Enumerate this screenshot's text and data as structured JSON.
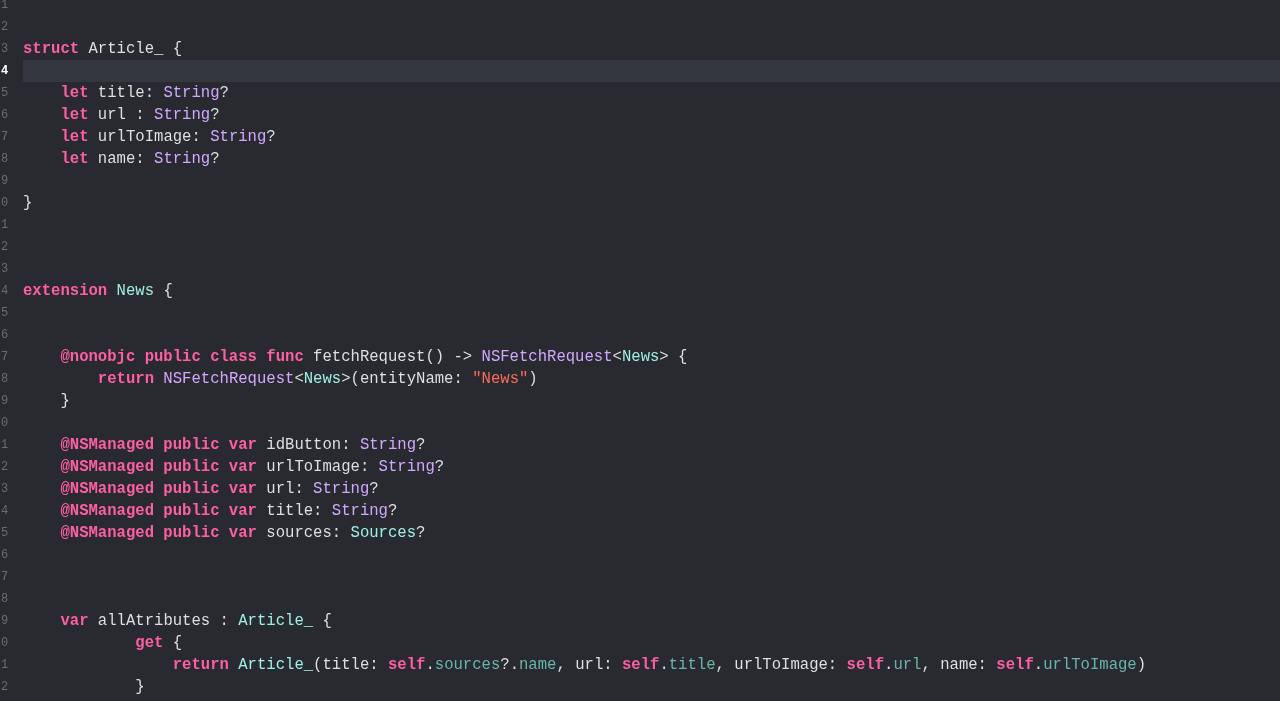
{
  "editor": {
    "lines": [
      {
        "number": "1",
        "current": false
      },
      {
        "number": "2",
        "current": false
      },
      {
        "number": "3",
        "current": false,
        "tokens": [
          {
            "kind": "keyword",
            "text": "struct"
          },
          {
            "kind": "plain",
            "text": " Article_ {"
          }
        ]
      },
      {
        "number": "4",
        "current": true
      },
      {
        "number": "5",
        "current": false,
        "tokens": [
          {
            "kind": "keyword",
            "text": "    let"
          },
          {
            "kind": "plain",
            "text": " title: "
          },
          {
            "kind": "type",
            "text": "String"
          },
          {
            "kind": "plain",
            "text": "?"
          }
        ]
      },
      {
        "number": "6",
        "current": false,
        "tokens": [
          {
            "kind": "keyword",
            "text": "    let"
          },
          {
            "kind": "plain",
            "text": " url : "
          },
          {
            "kind": "type",
            "text": "String"
          },
          {
            "kind": "plain",
            "text": "?"
          }
        ]
      },
      {
        "number": "7",
        "current": false,
        "tokens": [
          {
            "kind": "keyword",
            "text": "    let"
          },
          {
            "kind": "plain",
            "text": " urlToImage: "
          },
          {
            "kind": "type",
            "text": "String"
          },
          {
            "kind": "plain",
            "text": "?"
          }
        ]
      },
      {
        "number": "8",
        "current": false,
        "tokens": [
          {
            "kind": "keyword",
            "text": "    let"
          },
          {
            "kind": "plain",
            "text": " name: "
          },
          {
            "kind": "type",
            "text": "String"
          },
          {
            "kind": "plain",
            "text": "?"
          }
        ]
      },
      {
        "number": "9",
        "current": false
      },
      {
        "number": "0",
        "current": false,
        "tokens": [
          {
            "kind": "plain",
            "text": "}"
          }
        ]
      },
      {
        "number": "1",
        "current": false
      },
      {
        "number": "2",
        "current": false
      },
      {
        "number": "3",
        "current": false
      },
      {
        "number": "4",
        "current": false,
        "tokens": [
          {
            "kind": "keyword",
            "text": "extension"
          },
          {
            "kind": "project-type",
            "text": " News"
          },
          {
            "kind": "plain",
            "text": " {"
          }
        ]
      },
      {
        "number": "5",
        "current": false
      },
      {
        "number": "6",
        "current": false
      },
      {
        "number": "7",
        "current": false,
        "tokens": [
          {
            "kind": "keyword",
            "text": "    @nonobjc public class func"
          },
          {
            "kind": "plain",
            "text": " fetchRequest() -> "
          },
          {
            "kind": "type",
            "text": "NSFetchRequest"
          },
          {
            "kind": "plain",
            "text": "<"
          },
          {
            "kind": "project-type",
            "text": "News"
          },
          {
            "kind": "plain",
            "text": "> {"
          }
        ]
      },
      {
        "number": "8",
        "current": false,
        "tokens": [
          {
            "kind": "keyword",
            "text": "        return"
          },
          {
            "kind": "type",
            "text": " NSFetchRequest"
          },
          {
            "kind": "plain",
            "text": "<"
          },
          {
            "kind": "project-type",
            "text": "News"
          },
          {
            "kind": "plain",
            "text": ">(entityName: "
          },
          {
            "kind": "string",
            "text": "\"News\""
          },
          {
            "kind": "plain",
            "text": ")"
          }
        ]
      },
      {
        "number": "9",
        "current": false,
        "tokens": [
          {
            "kind": "plain",
            "text": "    }"
          }
        ]
      },
      {
        "number": "0",
        "current": false
      },
      {
        "number": "1",
        "current": false,
        "tokens": [
          {
            "kind": "keyword",
            "text": "    @NSManaged public var"
          },
          {
            "kind": "plain",
            "text": " idButton: "
          },
          {
            "kind": "type",
            "text": "String"
          },
          {
            "kind": "plain",
            "text": "?"
          }
        ]
      },
      {
        "number": "2",
        "current": false,
        "tokens": [
          {
            "kind": "keyword",
            "text": "    @NSManaged public var"
          },
          {
            "kind": "plain",
            "text": " urlToImage: "
          },
          {
            "kind": "type",
            "text": "String"
          },
          {
            "kind": "plain",
            "text": "?"
          }
        ]
      },
      {
        "number": "3",
        "current": false,
        "tokens": [
          {
            "kind": "keyword",
            "text": "    @NSManaged public var"
          },
          {
            "kind": "plain",
            "text": " url: "
          },
          {
            "kind": "type",
            "text": "String"
          },
          {
            "kind": "plain",
            "text": "?"
          }
        ]
      },
      {
        "number": "4",
        "current": false,
        "tokens": [
          {
            "kind": "keyword",
            "text": "    @NSManaged public var"
          },
          {
            "kind": "plain",
            "text": " title: "
          },
          {
            "kind": "type",
            "text": "String"
          },
          {
            "kind": "plain",
            "text": "?"
          }
        ]
      },
      {
        "number": "5",
        "current": false,
        "tokens": [
          {
            "kind": "keyword",
            "text": "    @NSManaged public var"
          },
          {
            "kind": "plain",
            "text": " sources: "
          },
          {
            "kind": "project-type",
            "text": "Sources"
          },
          {
            "kind": "plain",
            "text": "?"
          }
        ]
      },
      {
        "number": "6",
        "current": false
      },
      {
        "number": "7",
        "current": false
      },
      {
        "number": "8",
        "current": false
      },
      {
        "number": "9",
        "current": false,
        "tokens": [
          {
            "kind": "keyword",
            "text": "    var"
          },
          {
            "kind": "plain",
            "text": " allAtributes : "
          },
          {
            "kind": "project-type",
            "text": "Article_"
          },
          {
            "kind": "plain",
            "text": " {"
          }
        ]
      },
      {
        "number": "0",
        "current": false,
        "tokens": [
          {
            "kind": "keyword",
            "text": "            get"
          },
          {
            "kind": "plain",
            "text": " {"
          }
        ]
      },
      {
        "number": "1",
        "current": false,
        "tokens": [
          {
            "kind": "keyword",
            "text": "                return"
          },
          {
            "kind": "project-type",
            "text": " Article_"
          },
          {
            "kind": "plain",
            "text": "(title: "
          },
          {
            "kind": "keyword",
            "text": "self"
          },
          {
            "kind": "plain",
            "text": "."
          },
          {
            "kind": "member",
            "text": "sources"
          },
          {
            "kind": "plain",
            "text": "?."
          },
          {
            "kind": "member",
            "text": "name"
          },
          {
            "kind": "plain",
            "text": ", url: "
          },
          {
            "kind": "keyword",
            "text": "self"
          },
          {
            "kind": "plain",
            "text": "."
          },
          {
            "kind": "member",
            "text": "title"
          },
          {
            "kind": "plain",
            "text": ", urlToImage: "
          },
          {
            "kind": "keyword",
            "text": "self"
          },
          {
            "kind": "plain",
            "text": "."
          },
          {
            "kind": "member",
            "text": "url"
          },
          {
            "kind": "plain",
            "text": ", name: "
          },
          {
            "kind": "keyword",
            "text": "self"
          },
          {
            "kind": "plain",
            "text": "."
          },
          {
            "kind": "member",
            "text": "urlToImage"
          },
          {
            "kind": "plain",
            "text": ")"
          }
        ]
      },
      {
        "number": "2",
        "current": false,
        "tokens": [
          {
            "kind": "plain",
            "text": "            }"
          }
        ]
      }
    ]
  }
}
